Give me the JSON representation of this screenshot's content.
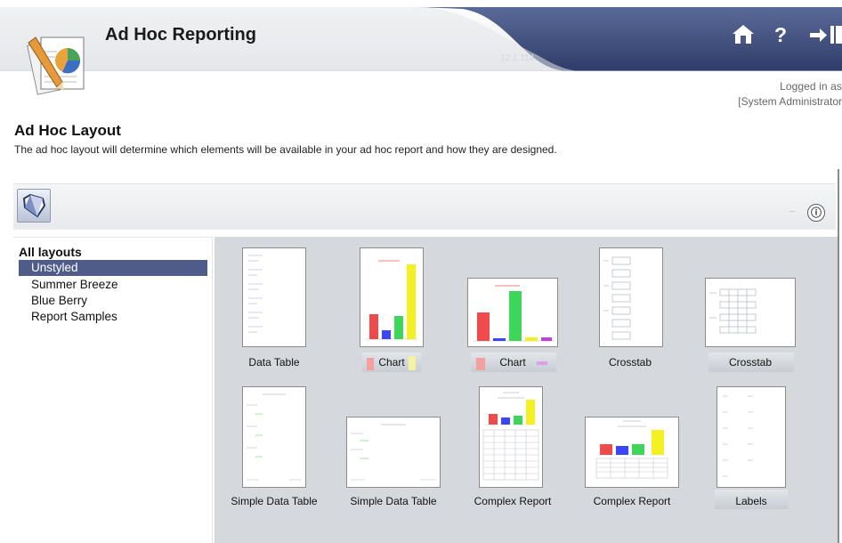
{
  "header": {
    "app_title": "Ad Hoc Reporting",
    "version": "12.1.114",
    "icons": {
      "home": "home-icon",
      "help": "help-icon",
      "logout": "logout-icon"
    },
    "help_glyph": "?",
    "logged_in_line1": "Logged in as",
    "logged_in_line2": "[System Administrator"
  },
  "page": {
    "title": "Ad Hoc Layout",
    "description": "The ad hoc layout will determine which elements will be available in your ad hoc report and how they are designed."
  },
  "toolbar": {
    "main_icon": "layout-icon",
    "info_glyph": "ⓘ"
  },
  "tree": {
    "root_label": "All layouts",
    "items": [
      {
        "label": "Unstyled",
        "selected": true
      },
      {
        "label": "Summer Breeze",
        "selected": false
      },
      {
        "label": "Blue Berry",
        "selected": false
      },
      {
        "label": "Report Samples",
        "selected": false
      }
    ]
  },
  "layouts": [
    {
      "label": "Data Table",
      "kind": "table-portrait"
    },
    {
      "label": "Chart",
      "kind": "chart-portrait"
    },
    {
      "label": "Chart",
      "kind": "chart-landscape"
    },
    {
      "label": "Crosstab",
      "kind": "crosstab-portrait"
    },
    {
      "label": "Crosstab",
      "kind": "crosstab-landscape"
    },
    {
      "label": "Simple Data Table",
      "kind": "simple-portrait"
    },
    {
      "label": "Simple Data Table",
      "kind": "simple-landscape"
    },
    {
      "label": "Complex Report",
      "kind": "complex-portrait"
    },
    {
      "label": "Complex Report",
      "kind": "complex-landscape"
    },
    {
      "label": "Labels",
      "kind": "labels-portrait"
    }
  ],
  "colors": {
    "banner_blue": "#3f4e7d",
    "selected_row": "#4f5c8a",
    "grid_bg": "#d5d9de",
    "bar_red": "#f04a4a",
    "bar_blue": "#3b45ff",
    "bar_green": "#3ed65a",
    "bar_yellow": "#f4f022",
    "bar_purple": "#c040d8"
  }
}
